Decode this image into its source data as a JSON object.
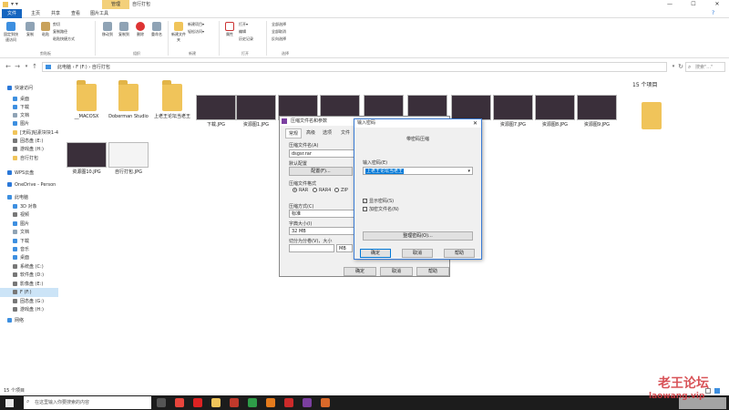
{
  "window": {
    "manage_tab": "管理",
    "title": "自行打包",
    "controls": [
      "—",
      "☐",
      "✕"
    ]
  },
  "ribbon_tabs": {
    "file": "文件",
    "tabs": [
      "主页",
      "共享",
      "查看",
      "图片工具"
    ]
  },
  "ribbon": {
    "pin_label": "固定到快速访问",
    "copy_label": "复制",
    "paste_label": "粘贴",
    "cut_label": "剪切",
    "copy_path_label": "复制路径",
    "paste_shortcut_label": "粘贴快捷方式",
    "clipboard_group": "剪贴板",
    "move_to_label": "移动到",
    "copy_to_label": "复制到",
    "delete_label": "删除",
    "rename_label": "重命名",
    "organize_group": "组织",
    "new_folder_label": "新建文件夹",
    "new_item_label": "新建项目▾",
    "easy_access_label": "轻松访问▾",
    "new_group": "新建",
    "properties_label": "属性",
    "open_label": "打开▾",
    "edit_label": "编辑",
    "history_label": "历史记录",
    "open_group": "打开",
    "select_all_label": "全部选择",
    "select_none_label": "全部取消",
    "invert_label": "反向选择",
    "select_group": "选择"
  },
  "address": {
    "path": "此电脑 › F (F:) › 自行打包",
    "search_placeholder": "搜索\"...\""
  },
  "sidebar": {
    "items": [
      {
        "label": "快速访问",
        "color": "#2b78d8"
      },
      {
        "label": "桌面",
        "color": "#3d8fe0"
      },
      {
        "label": "下载",
        "color": "#3d8fe0"
      },
      {
        "label": "文档",
        "color": "#8fa3b5"
      },
      {
        "label": "图片",
        "color": "#3d8fe0"
      },
      {
        "label": "[无码]帖素块块1-4",
        "color": "#f0c45a"
      },
      {
        "label": "固态盘 (E:)",
        "color": "#777"
      },
      {
        "label": "游戏盘 (H:)",
        "color": "#777"
      },
      {
        "label": "自行打包",
        "color": "#f0c45a"
      },
      {
        "label": "WPS云盘",
        "color": "#2b78d8"
      },
      {
        "label": "OneDrive - Person",
        "color": "#2b78d8"
      },
      {
        "label": "此电脑",
        "color": "#3d8fe0"
      },
      {
        "label": "3D 对象",
        "color": "#3d8fe0"
      },
      {
        "label": "视频",
        "color": "#777"
      },
      {
        "label": "图片",
        "color": "#3d8fe0"
      },
      {
        "label": "文档",
        "color": "#8fa3b5"
      },
      {
        "label": "下载",
        "color": "#3d8fe0"
      },
      {
        "label": "音乐",
        "color": "#3d8fe0"
      },
      {
        "label": "桌面",
        "color": "#3d8fe0"
      },
      {
        "label": "系统盘 (C:)",
        "color": "#777"
      },
      {
        "label": "软件盘 (D:)",
        "color": "#777"
      },
      {
        "label": "影像盘 (E:)",
        "color": "#777"
      },
      {
        "label": "F (F:)",
        "color": "#777"
      },
      {
        "label": "固态盘 (G:)",
        "color": "#777"
      },
      {
        "label": "游戏盘 (H:)",
        "color": "#777"
      },
      {
        "label": "网络",
        "color": "#3d8fe0"
      }
    ]
  },
  "files": {
    "row1": [
      {
        "name": "__MACOSX",
        "kind": "folder"
      },
      {
        "name": "Doberman Studio",
        "kind": "folder"
      },
      {
        "name": "上老王论坛当老王",
        "kind": "folder"
      },
      {
        "name": "下载.JPG",
        "kind": "image"
      },
      {
        "name": "资源图1.JPG",
        "kind": "image"
      },
      {
        "name": "",
        "kind": "image"
      },
      {
        "name": "",
        "kind": "image"
      },
      {
        "name": "",
        "kind": "image"
      },
      {
        "name": "",
        "kind": "image"
      },
      {
        "name": "",
        "kind": "image"
      },
      {
        "name": "资源图7.JPG",
        "kind": "image"
      },
      {
        "name": "资源图8.JPG",
        "kind": "image"
      },
      {
        "name": "资源图9.JPG",
        "kind": "image"
      }
    ],
    "row2": [
      {
        "name": "资源图10.JPG",
        "kind": "image"
      },
      {
        "name": "自行打包.JPG",
        "kind": "image"
      }
    ],
    "count_right": "15 个项目"
  },
  "dialog1": {
    "title": "压缩文件名和参数",
    "tabs": [
      "常规",
      "高级",
      "选项",
      "文件"
    ],
    "archive_name_label": "压缩文件名(A)",
    "archive_name": "dsgsr.rar",
    "profile_label": "默认配置",
    "profile_button": "配置(F)...",
    "format_label": "压缩文件格式",
    "formats": [
      "RAR",
      "RAR4",
      "ZIP"
    ],
    "method_label": "压缩方式(C)",
    "method": "标准",
    "dict_label": "字典大小(I)",
    "dict": "32 MB",
    "split_label": "切分为分卷(V)，大小",
    "split_unit": "MB",
    "ok": "确定",
    "cancel": "取消",
    "help": "帮助"
  },
  "dialog2": {
    "title": "输入密码",
    "heading": "带密码压缩",
    "password_label": "输入密码(E)",
    "password_value": "上老王论坛当老王",
    "show_password": "显示密码(S)",
    "encrypt_names": "加密文件名(N)",
    "organize_button": "整理密码(O)...",
    "ok": "确定",
    "cancel": "取消",
    "help": "帮助"
  },
  "statusbar": {
    "count": "15 个项目"
  },
  "taskbar": {
    "search_placeholder": "在这里输入你要搜索的内容",
    "icons": [
      {
        "name": "task-view-icon",
        "color": "#555"
      },
      {
        "name": "chrome-icon",
        "color": "#e8453c"
      },
      {
        "name": "yandex-icon",
        "color": "#d22"
      },
      {
        "name": "folder-taskbar-icon",
        "color": "#f0c45a"
      },
      {
        "name": "app-red-icon",
        "color": "#c0392b"
      },
      {
        "name": "app-green-icon",
        "color": "#2e9c48"
      },
      {
        "name": "search-app-icon",
        "color": "#e57b1d"
      },
      {
        "name": "app-red2-icon",
        "color": "#cc2a2a"
      },
      {
        "name": "winrar-icon",
        "color": "#7b3fa0"
      },
      {
        "name": "app-orange-icon",
        "color": "#d9692a"
      }
    ]
  },
  "watermark": {
    "line1": "老王论坛",
    "line2": "laowang.vip"
  }
}
